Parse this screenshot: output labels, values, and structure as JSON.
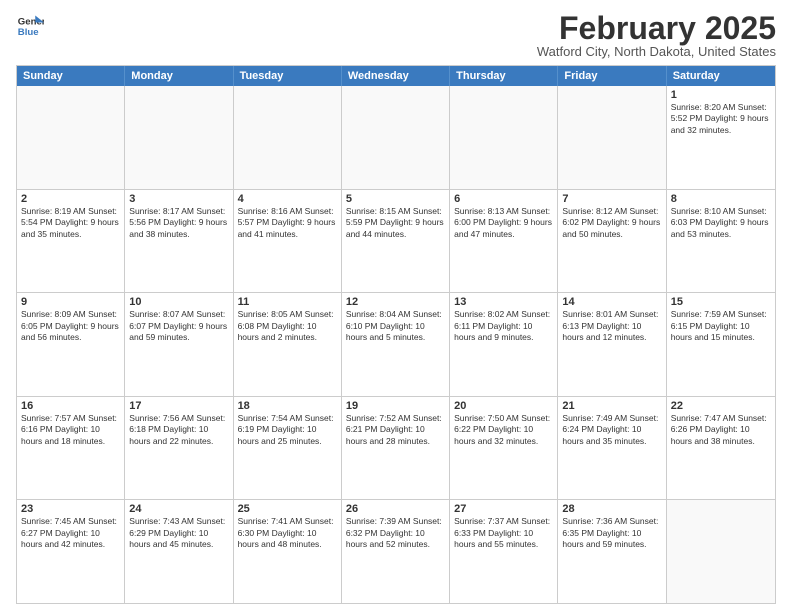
{
  "header": {
    "logo_line1": "General",
    "logo_line2": "Blue",
    "month": "February 2025",
    "location": "Watford City, North Dakota, United States"
  },
  "weekdays": [
    "Sunday",
    "Monday",
    "Tuesday",
    "Wednesday",
    "Thursday",
    "Friday",
    "Saturday"
  ],
  "rows": [
    [
      {
        "day": "",
        "info": ""
      },
      {
        "day": "",
        "info": ""
      },
      {
        "day": "",
        "info": ""
      },
      {
        "day": "",
        "info": ""
      },
      {
        "day": "",
        "info": ""
      },
      {
        "day": "",
        "info": ""
      },
      {
        "day": "1",
        "info": "Sunrise: 8:20 AM\nSunset: 5:52 PM\nDaylight: 9 hours and 32 minutes."
      }
    ],
    [
      {
        "day": "2",
        "info": "Sunrise: 8:19 AM\nSunset: 5:54 PM\nDaylight: 9 hours and 35 minutes."
      },
      {
        "day": "3",
        "info": "Sunrise: 8:17 AM\nSunset: 5:56 PM\nDaylight: 9 hours and 38 minutes."
      },
      {
        "day": "4",
        "info": "Sunrise: 8:16 AM\nSunset: 5:57 PM\nDaylight: 9 hours and 41 minutes."
      },
      {
        "day": "5",
        "info": "Sunrise: 8:15 AM\nSunset: 5:59 PM\nDaylight: 9 hours and 44 minutes."
      },
      {
        "day": "6",
        "info": "Sunrise: 8:13 AM\nSunset: 6:00 PM\nDaylight: 9 hours and 47 minutes."
      },
      {
        "day": "7",
        "info": "Sunrise: 8:12 AM\nSunset: 6:02 PM\nDaylight: 9 hours and 50 minutes."
      },
      {
        "day": "8",
        "info": "Sunrise: 8:10 AM\nSunset: 6:03 PM\nDaylight: 9 hours and 53 minutes."
      }
    ],
    [
      {
        "day": "9",
        "info": "Sunrise: 8:09 AM\nSunset: 6:05 PM\nDaylight: 9 hours and 56 minutes."
      },
      {
        "day": "10",
        "info": "Sunrise: 8:07 AM\nSunset: 6:07 PM\nDaylight: 9 hours and 59 minutes."
      },
      {
        "day": "11",
        "info": "Sunrise: 8:05 AM\nSunset: 6:08 PM\nDaylight: 10 hours and 2 minutes."
      },
      {
        "day": "12",
        "info": "Sunrise: 8:04 AM\nSunset: 6:10 PM\nDaylight: 10 hours and 5 minutes."
      },
      {
        "day": "13",
        "info": "Sunrise: 8:02 AM\nSunset: 6:11 PM\nDaylight: 10 hours and 9 minutes."
      },
      {
        "day": "14",
        "info": "Sunrise: 8:01 AM\nSunset: 6:13 PM\nDaylight: 10 hours and 12 minutes."
      },
      {
        "day": "15",
        "info": "Sunrise: 7:59 AM\nSunset: 6:15 PM\nDaylight: 10 hours and 15 minutes."
      }
    ],
    [
      {
        "day": "16",
        "info": "Sunrise: 7:57 AM\nSunset: 6:16 PM\nDaylight: 10 hours and 18 minutes."
      },
      {
        "day": "17",
        "info": "Sunrise: 7:56 AM\nSunset: 6:18 PM\nDaylight: 10 hours and 22 minutes."
      },
      {
        "day": "18",
        "info": "Sunrise: 7:54 AM\nSunset: 6:19 PM\nDaylight: 10 hours and 25 minutes."
      },
      {
        "day": "19",
        "info": "Sunrise: 7:52 AM\nSunset: 6:21 PM\nDaylight: 10 hours and 28 minutes."
      },
      {
        "day": "20",
        "info": "Sunrise: 7:50 AM\nSunset: 6:22 PM\nDaylight: 10 hours and 32 minutes."
      },
      {
        "day": "21",
        "info": "Sunrise: 7:49 AM\nSunset: 6:24 PM\nDaylight: 10 hours and 35 minutes."
      },
      {
        "day": "22",
        "info": "Sunrise: 7:47 AM\nSunset: 6:26 PM\nDaylight: 10 hours and 38 minutes."
      }
    ],
    [
      {
        "day": "23",
        "info": "Sunrise: 7:45 AM\nSunset: 6:27 PM\nDaylight: 10 hours and 42 minutes."
      },
      {
        "day": "24",
        "info": "Sunrise: 7:43 AM\nSunset: 6:29 PM\nDaylight: 10 hours and 45 minutes."
      },
      {
        "day": "25",
        "info": "Sunrise: 7:41 AM\nSunset: 6:30 PM\nDaylight: 10 hours and 48 minutes."
      },
      {
        "day": "26",
        "info": "Sunrise: 7:39 AM\nSunset: 6:32 PM\nDaylight: 10 hours and 52 minutes."
      },
      {
        "day": "27",
        "info": "Sunrise: 7:37 AM\nSunset: 6:33 PM\nDaylight: 10 hours and 55 minutes."
      },
      {
        "day": "28",
        "info": "Sunrise: 7:36 AM\nSunset: 6:35 PM\nDaylight: 10 hours and 59 minutes."
      },
      {
        "day": "",
        "info": ""
      }
    ]
  ]
}
